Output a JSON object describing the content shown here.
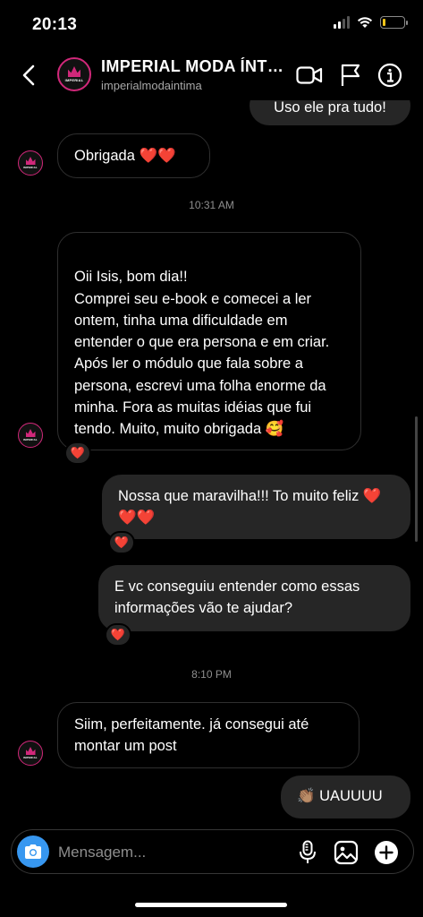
{
  "status": {
    "time": "20:13",
    "battery_level": 0.15,
    "battery_color": "#f0c419"
  },
  "header": {
    "back_icon": "chevron-left-icon",
    "title": "IMPERIAL MODA ÍNTIMA",
    "username": "imperialmodaintima",
    "avatar_brand": "IMPERIAL MODA ÍNTIMA",
    "actions": [
      "video-camera-icon",
      "flag-icon",
      "info-icon"
    ]
  },
  "messages": [
    {
      "id": "m1",
      "direction": "out",
      "text": "Uso ele pra tudo!"
    },
    {
      "id": "m2",
      "direction": "in",
      "text": "Obrigada ❤️❤️"
    },
    {
      "id": "t1",
      "type": "timestamp",
      "text": "10:31 AM"
    },
    {
      "id": "m3",
      "direction": "in",
      "text": "Oii Isis, bom dia!!\nComprei seu e-book e comecei a ler ontem, tinha uma dificuldade em entender o que era persona e em criar. Após ler o módulo que fala sobre a persona, escrevi uma folha enorme da minha. Fora as muitas idéias que fui tendo. Muito, muito obrigada 🥰",
      "reaction": "❤️"
    },
    {
      "id": "m4",
      "direction": "out",
      "text": "Nossa que maravilha!!! To muito feliz ❤️❤️❤️",
      "reaction": "❤️"
    },
    {
      "id": "m5",
      "direction": "out",
      "text": "E vc conseguiu entender como essas informações vão te ajudar?",
      "reaction": "❤️"
    },
    {
      "id": "t2",
      "type": "timestamp",
      "text": "8:10 PM"
    },
    {
      "id": "m6",
      "direction": "in",
      "text": "Siim, perfeitamente. já consegui até montar um post"
    },
    {
      "id": "m7",
      "direction": "out",
      "text": "👏🏽 UAUUUU"
    }
  ],
  "composer": {
    "placeholder": "Mensagem...",
    "left_icon": "camera-icon",
    "right_icons": [
      "microphone-icon",
      "image-icon",
      "plus-icon"
    ]
  },
  "colors": {
    "accent_blue": "#3797f0",
    "outgoing_bubble": "#262626",
    "incoming_border": "#2f2f2f",
    "avatar_ring": "#d1287a",
    "heart": "#e8273d"
  }
}
